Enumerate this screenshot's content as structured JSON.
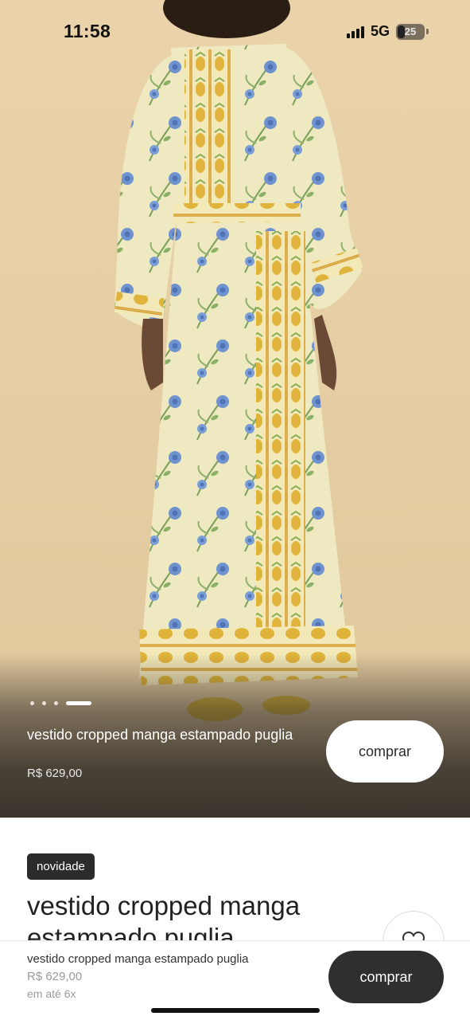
{
  "status_bar": {
    "time": "11:58",
    "network": "5G",
    "battery_level": "25"
  },
  "hero": {
    "image_alt": "vestido cropped manga estampado puglia",
    "carousel": {
      "total": 4,
      "active_index": 3
    },
    "product_name": "vestido cropped manga estampado puglia",
    "price": "R$ 629,00",
    "buy_label": "comprar"
  },
  "details": {
    "badge": "novidade",
    "title": "vestido cropped manga estampado puglia",
    "favorite_icon": "heart-icon"
  },
  "bottom_bar": {
    "product_name": "vestido cropped manga estampado puglia",
    "price": "R$ 629,00",
    "installments": "em até 6x",
    "buy_label": "comprar"
  },
  "colors": {
    "background_beige": "#e6cfa6",
    "dress_cream": "#f1ecc7",
    "print_blue": "#6f93cf",
    "print_yellow": "#e0b43a",
    "dark_button": "#2f2f2f"
  }
}
